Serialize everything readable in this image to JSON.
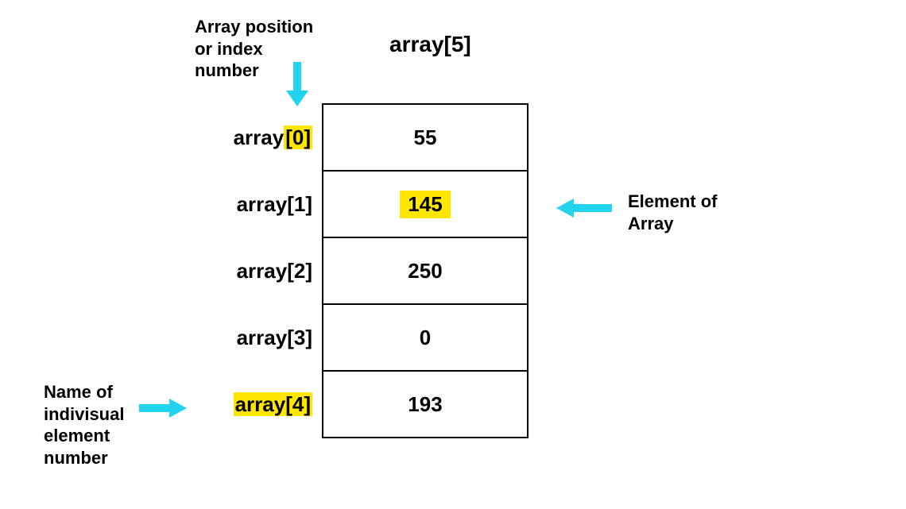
{
  "title": "array[5]",
  "annotations": {
    "index": "Array position\nor index\nnumber",
    "element": "Element of\nArray",
    "name": "Name of\nindivisual\nelement\nnumber"
  },
  "rows": [
    {
      "label_plain": "array",
      "label_hi": "[0]",
      "label_after": "",
      "value": "55",
      "value_hi": false,
      "label_all_hi": false
    },
    {
      "label_plain": "array[1]",
      "label_hi": "",
      "label_after": "",
      "value": "145",
      "value_hi": true,
      "label_all_hi": false
    },
    {
      "label_plain": "array[2]",
      "label_hi": "",
      "label_after": "",
      "value": "250",
      "value_hi": false,
      "label_all_hi": false
    },
    {
      "label_plain": "array[3]",
      "label_hi": "",
      "label_after": "",
      "value": "0",
      "value_hi": false,
      "label_all_hi": false
    },
    {
      "label_plain": "",
      "label_hi": "array[4]",
      "label_after": "",
      "value": "193",
      "value_hi": false,
      "label_all_hi": true
    }
  ]
}
